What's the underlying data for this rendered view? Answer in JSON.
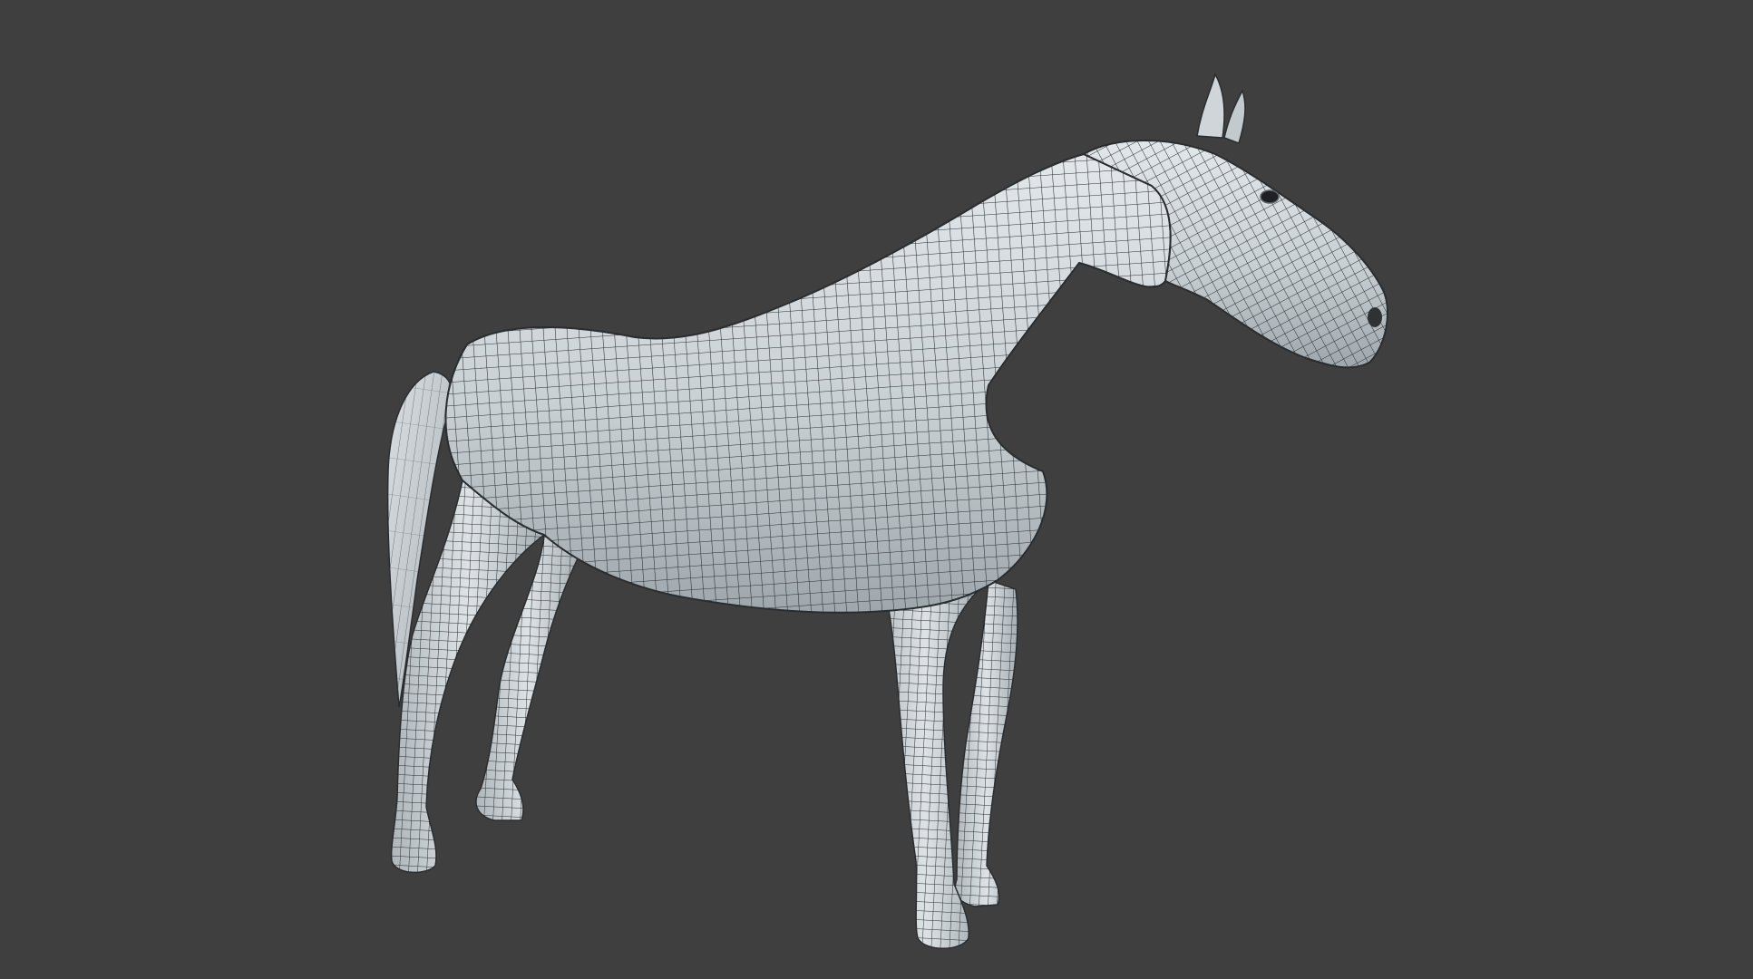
{
  "viewport": {
    "background_color": "#3f3f3f",
    "shading": "solid-with-wireframe"
  },
  "model": {
    "subject": "horse",
    "view": "side-three-quarter",
    "surface_color": "#d3d9dc",
    "shade_color": "#8e979c",
    "wire_color": "#2a2d30"
  }
}
